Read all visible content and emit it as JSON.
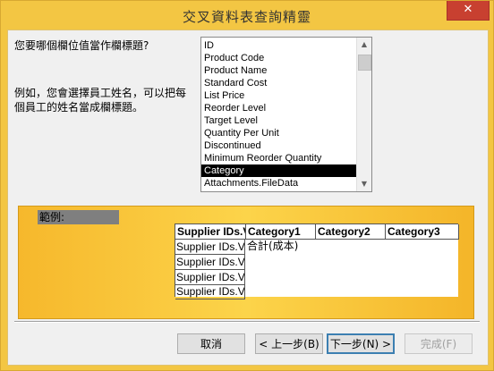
{
  "window": {
    "title": "交叉資料表查詢精靈",
    "close_label": "✕"
  },
  "question": "您要哪個欄位值當作欄標題?",
  "example_text": "例如，您會選擇員工姓名，可以把每個員工的姓名當成欄標題。",
  "fields": {
    "items": [
      "ID",
      "Product Code",
      "Product Name",
      "Standard Cost",
      "List Price",
      "Reorder Level",
      "Target Level",
      "Quantity Per Unit",
      "Discontinued",
      "Minimum Reorder Quantity",
      "Category",
      "Attachments.FileData"
    ],
    "selected": "Category"
  },
  "sample": {
    "label": "範例:",
    "headers": [
      "Supplier IDs.V",
      "Category1",
      "Category2",
      "Category3"
    ],
    "row_labels": [
      "Supplier IDs.Val",
      "Supplier IDs.Val",
      "Supplier IDs.Val",
      "Supplier IDs.Val"
    ],
    "summary": "合計(成本)"
  },
  "buttons": {
    "cancel": "取消",
    "back": "< 上一步(B)",
    "next": "下一步(N) >",
    "finish": "完成(F)"
  },
  "colors": {
    "accent": "#f3c643",
    "selection": "#000000",
    "focus_border": "#3c7fb1"
  }
}
